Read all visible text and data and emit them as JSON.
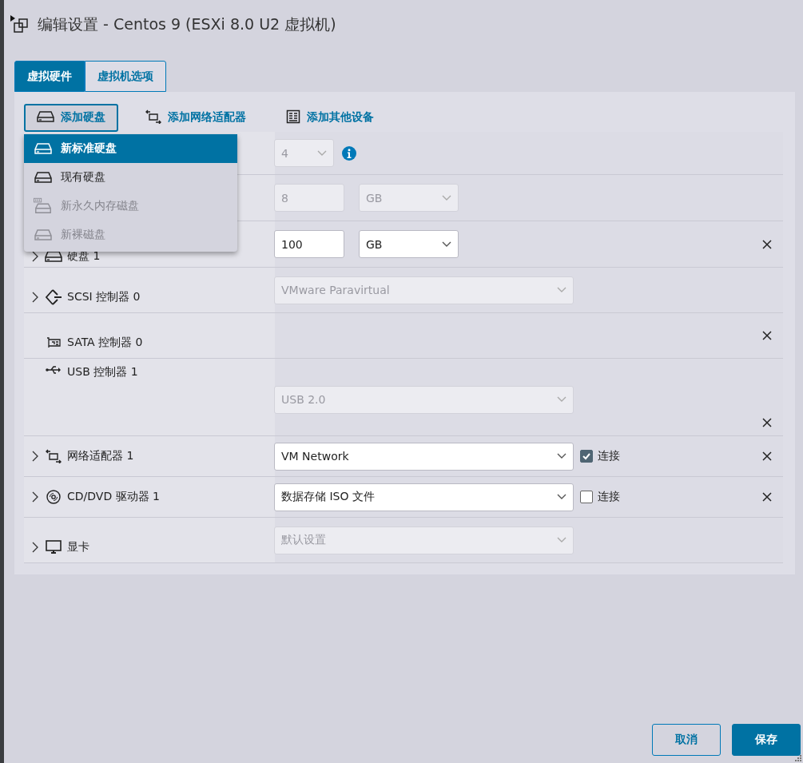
{
  "window": {
    "title": "编辑设置 - Centos 9 (ESXi 8.0 U2 虚拟机)"
  },
  "tabs": [
    {
      "label": "虚拟硬件",
      "selected": true
    },
    {
      "label": "虚拟机选项",
      "selected": false
    }
  ],
  "toolbar": [
    {
      "label": "添加硬盘",
      "kind": "disk",
      "expanded": true
    },
    {
      "label": "添加网络适配器",
      "kind": "network",
      "expanded": false
    },
    {
      "label": "添加其他设备",
      "kind": "device",
      "expanded": false
    }
  ],
  "add_disk_menu": [
    {
      "label": "新标准硬盘",
      "kind": "disk",
      "selected": true,
      "disabled": false
    },
    {
      "label": "现有硬盘",
      "kind": "disk",
      "selected": false,
      "disabled": false
    },
    {
      "label": "新永久内存磁盘",
      "kind": "pmem",
      "selected": false,
      "disabled": true
    },
    {
      "label": "新裸磁盘",
      "kind": "disk",
      "selected": false,
      "disabled": true
    }
  ],
  "devices": [
    {
      "kind": "cpu",
      "expandable": false,
      "removable": false,
      "controls": [
        {
          "kind": "select",
          "value": "4",
          "disabled": true
        },
        {
          "kind": "info"
        }
      ]
    },
    {
      "kind": "memory",
      "expandable": false,
      "removable": false,
      "controls": [
        {
          "kind": "input",
          "value": "8",
          "disabled": true
        },
        {
          "kind": "select",
          "value": "GB",
          "disabled": true
        }
      ]
    },
    {
      "kind": "disk",
      "label": "硬盘 1",
      "expandable": true,
      "removable": true,
      "controls": [
        {
          "kind": "input",
          "value": "100",
          "disabled": false
        },
        {
          "kind": "select",
          "value": "GB",
          "disabled": false
        }
      ]
    },
    {
      "kind": "scsi",
      "label": "SCSI 控制器 0",
      "expandable": true,
      "removable": false,
      "controls": [
        {
          "kind": "select",
          "value": "VMware Paravirtual",
          "disabled": true
        }
      ]
    },
    {
      "kind": "sata",
      "label": "SATA 控制器 0",
      "expandable": false,
      "removable": true
    },
    {
      "kind": "usb",
      "label": "USB 控制器 1",
      "expandable": false,
      "removable": true,
      "controls": [
        {
          "kind": "select",
          "value": "USB 2.0",
          "disabled": true
        }
      ]
    },
    {
      "kind": "network",
      "label": "网络适配器 1",
      "expandable": true,
      "removable": true,
      "controls": [
        {
          "kind": "select",
          "value": "VM Network",
          "disabled": false
        },
        {
          "kind": "checkbox",
          "label": "连接",
          "checked": true
        }
      ]
    },
    {
      "kind": "cd",
      "label": "CD/DVD 驱动器 1",
      "expandable": true,
      "removable": true,
      "controls": [
        {
          "kind": "select",
          "value": "数据存储 ISO 文件",
          "disabled": false
        },
        {
          "kind": "checkbox",
          "label": "连接",
          "checked": false
        }
      ]
    },
    {
      "kind": "monitor",
      "label": "显卡",
      "expandable": true,
      "removable": false,
      "controls": [
        {
          "kind": "select",
          "value": "默认设置",
          "disabled": true
        }
      ]
    }
  ],
  "footer": [
    {
      "label": "取消",
      "kind": "secondary"
    },
    {
      "label": "保存",
      "kind": "primary"
    }
  ]
}
